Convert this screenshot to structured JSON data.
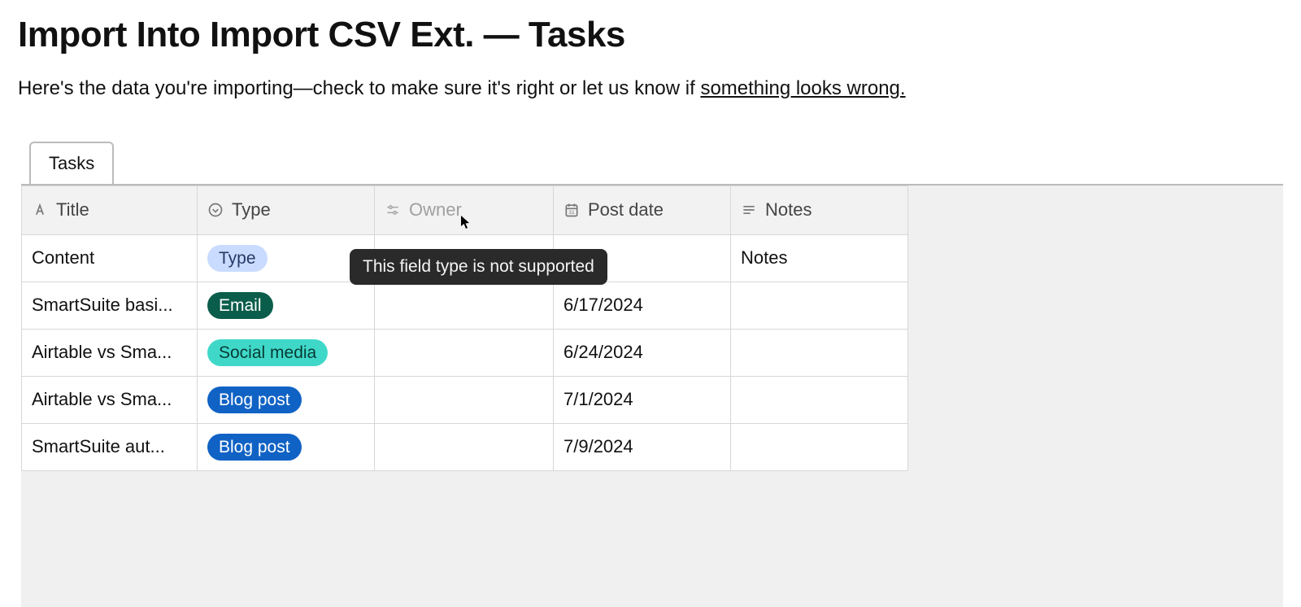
{
  "header": {
    "title": "Import Into Import CSV Ext. — Tasks",
    "subtitle_prefix": "Here's the data you're importing—check to make sure it's right or let us know if ",
    "subtitle_link": "something looks wrong."
  },
  "tabs": {
    "active": "Tasks"
  },
  "columns": {
    "title": "Title",
    "type": "Type",
    "owner": "Owner",
    "post_date": "Post date",
    "notes": "Notes"
  },
  "tooltip": {
    "owner_unsupported": "This field type is not supported"
  },
  "tag_colors": {
    "Type": "tag-light",
    "Email": "tag-green",
    "Social media": "tag-teal",
    "Blog post": "tag-blue"
  },
  "rows": [
    {
      "title": "Content",
      "type": "Type",
      "owner": "",
      "post_date": "",
      "notes": "Notes"
    },
    {
      "title": "SmartSuite basi...",
      "type": "Email",
      "owner": "",
      "post_date": "6/17/2024",
      "notes": ""
    },
    {
      "title": "Airtable vs Sma...",
      "type": "Social media",
      "owner": "",
      "post_date": "6/24/2024",
      "notes": ""
    },
    {
      "title": "Airtable vs Sma...",
      "type": "Blog post",
      "owner": "",
      "post_date": "7/1/2024",
      "notes": ""
    },
    {
      "title": "SmartSuite aut...",
      "type": "Blog post",
      "owner": "",
      "post_date": "7/9/2024",
      "notes": ""
    }
  ]
}
